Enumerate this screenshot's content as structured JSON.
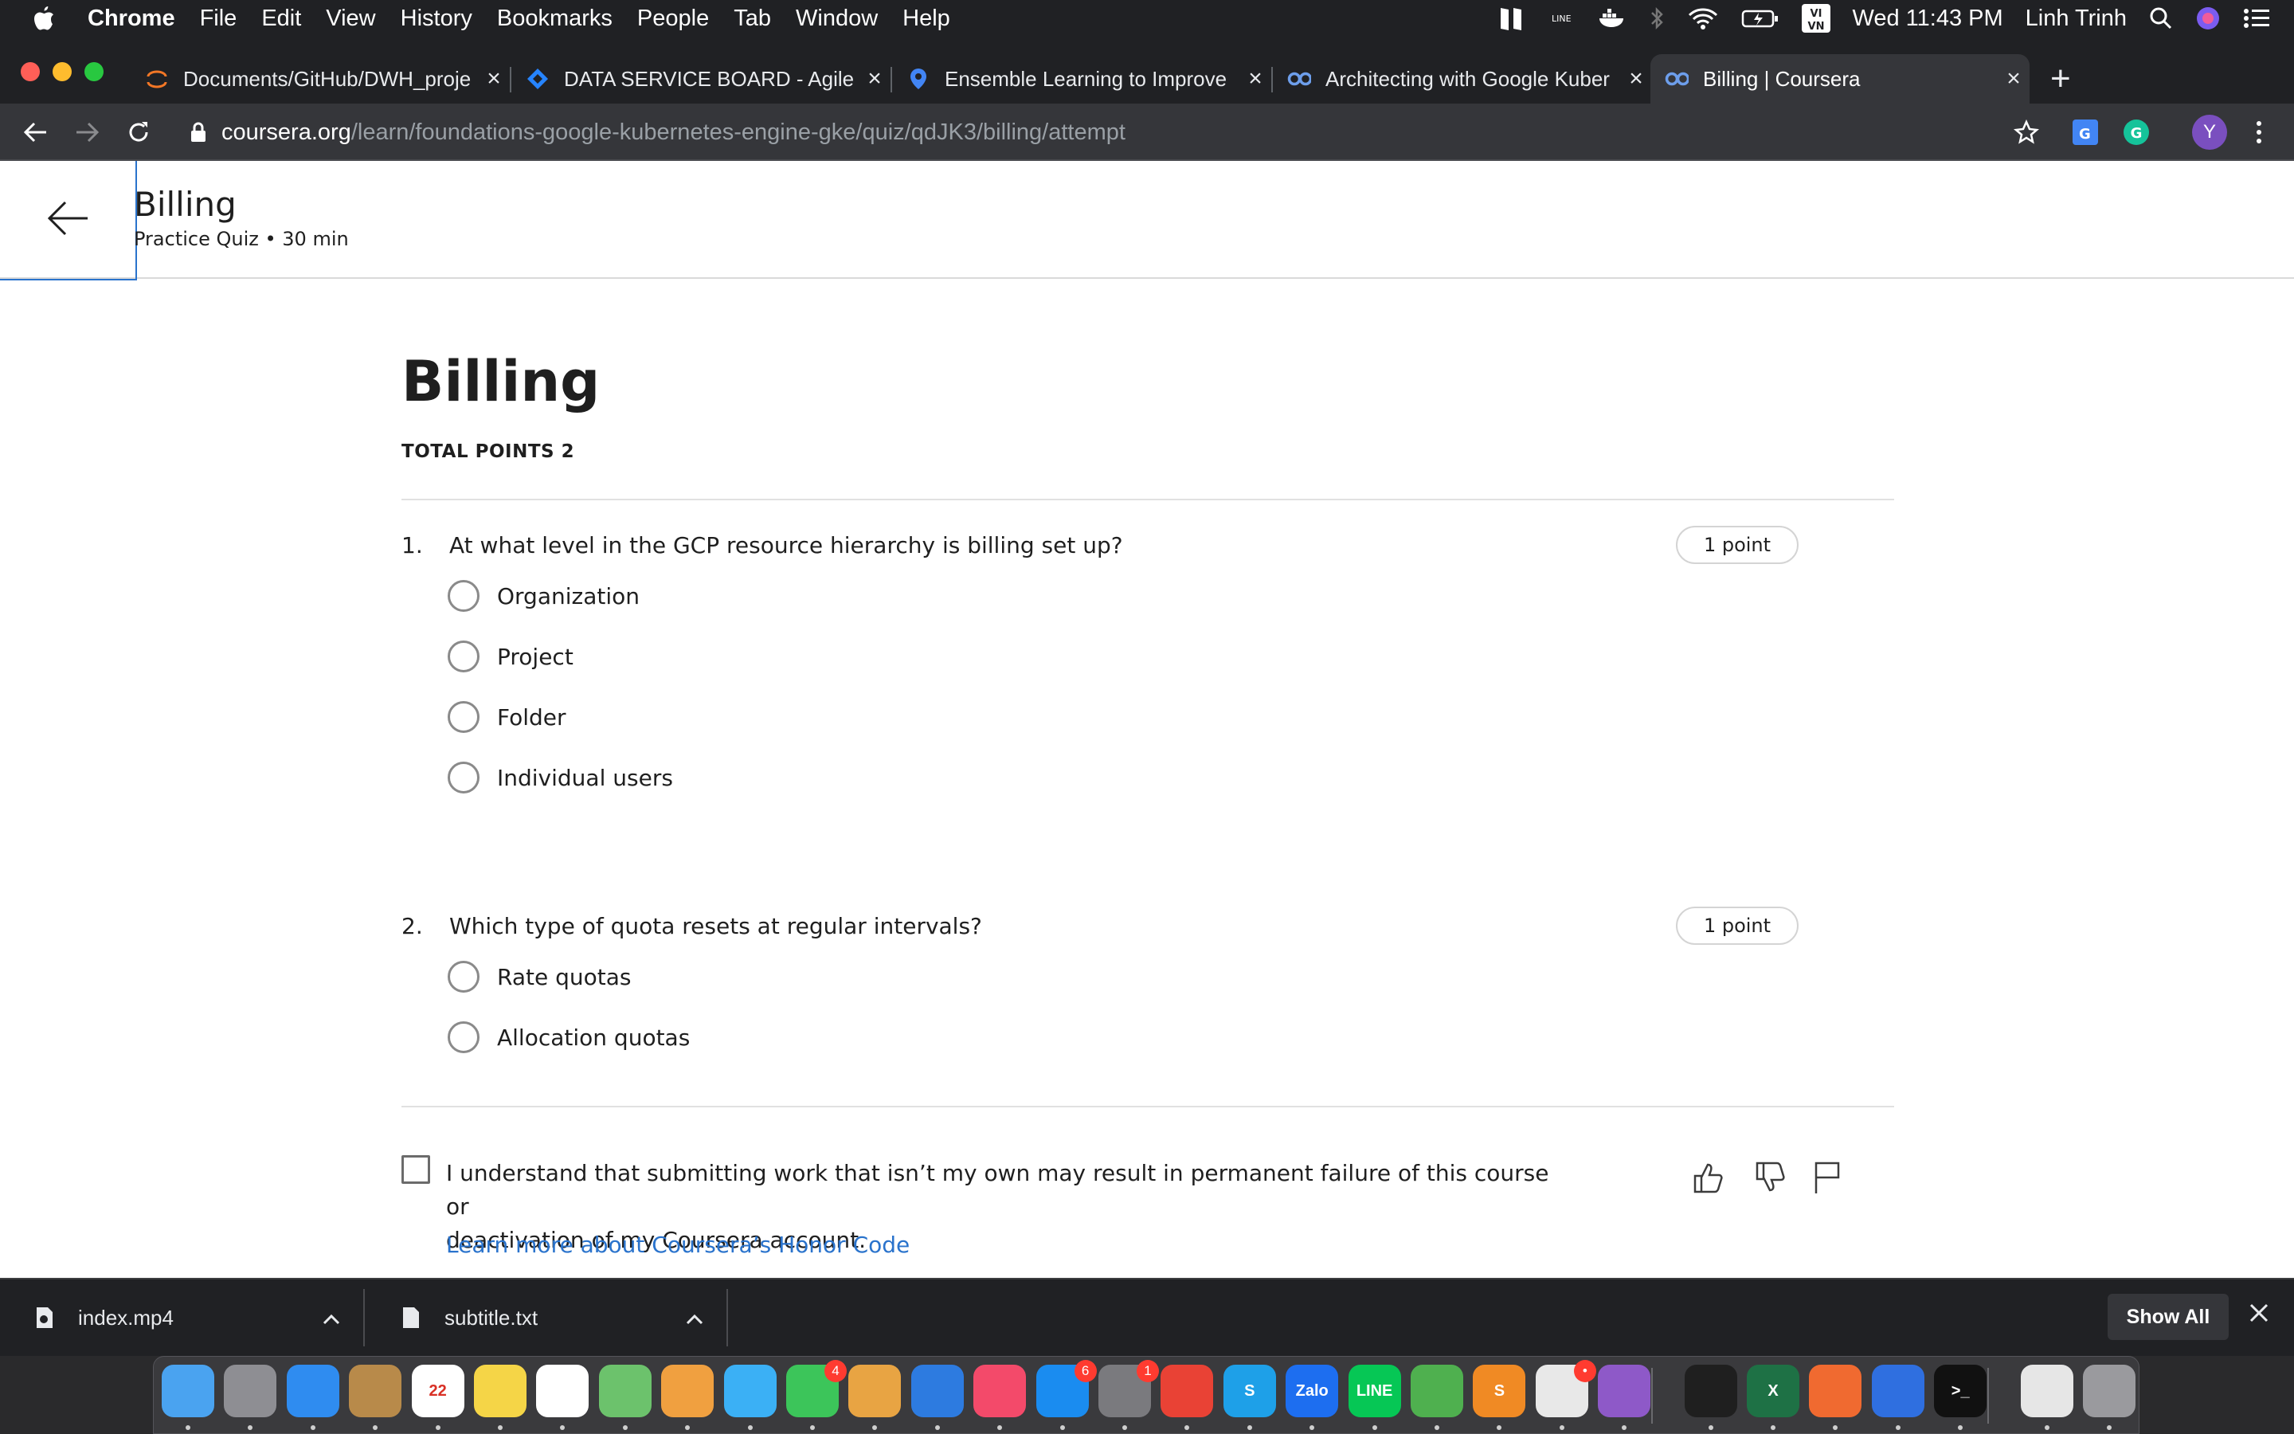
{
  "menubar": {
    "app_name": "Chrome",
    "menus": [
      "File",
      "Edit",
      "View",
      "History",
      "Bookmarks",
      "People",
      "Tab",
      "Window",
      "Help"
    ],
    "clock": "Wed 11:43 PM",
    "user": "Linh Trinh",
    "input_method": "VI VN",
    "status_icons": [
      "split-view-icon",
      "line-app-icon",
      "docker-icon",
      "bluetooth-icon",
      "wifi-icon",
      "battery-icon",
      "input-method-icon",
      "spotlight-icon",
      "siri-icon",
      "notification-center-icon"
    ]
  },
  "tabs": [
    {
      "title": "Documents/GitHub/DWH_proje",
      "icon": "jupyter-icon"
    },
    {
      "title": "DATA SERVICE BOARD - Agile B",
      "icon": "jira-icon"
    },
    {
      "title": "Ensemble Learning to Improve",
      "icon": "pin-icon"
    },
    {
      "title": "Architecting with Google Kuber",
      "icon": "coursera-icon"
    },
    {
      "title": "Billing | Coursera",
      "icon": "coursera-icon",
      "active": true
    }
  ],
  "address": {
    "host": "coursera.org",
    "path": "/learn/foundations-google-kubernetes-engine-gke/quiz/qdJK3/billing/attempt"
  },
  "profile_initial": "Y",
  "colors": {
    "chrome_dark": "#202124",
    "chrome_toolbar": "#35363a",
    "link_blue": "#2a73cc",
    "text_dark": "#1f1f1f"
  },
  "header": {
    "title": "Billing",
    "subtitle": "Practice Quiz • 30 min"
  },
  "quiz": {
    "title": "Billing",
    "total_points": "TOTAL POINTS 2",
    "questions": [
      {
        "number": "1.",
        "text": "At what level in the GCP resource hierarchy is billing set up?",
        "points": "1 point",
        "options": [
          "Organization",
          "Project",
          "Folder",
          "Individual users"
        ]
      },
      {
        "number": "2.",
        "text": "Which type of quota resets at regular intervals?",
        "points": "1 point",
        "options": [
          "Rate quotas",
          "Allocation quotas"
        ]
      }
    ]
  },
  "honor": {
    "line1": "I understand that submitting work that isn’t my own may result in permanent failure of this course or",
    "line2": "deactivation of my Coursera account.",
    "link": "Learn more about Coursera’s Honor Code"
  },
  "downloads": {
    "items": [
      {
        "name": "index.mp4",
        "icon": "video-file-icon"
      },
      {
        "name": "subtitle.txt",
        "icon": "text-file-icon"
      }
    ],
    "show_all": "Show All"
  },
  "dock": {
    "apps": [
      {
        "name": "finder",
        "color": "#4aa3f0",
        "label": ""
      },
      {
        "name": "launchpad",
        "color": "#8e8e93",
        "label": ""
      },
      {
        "name": "safari",
        "color": "#2f8cf0",
        "label": ""
      },
      {
        "name": "contacts",
        "color": "#b88a4a",
        "label": ""
      },
      {
        "name": "calendar",
        "color": "#ffffff",
        "label": "22"
      },
      {
        "name": "notes",
        "color": "#f5d547",
        "label": ""
      },
      {
        "name": "reminders",
        "color": "#ffffff",
        "label": ""
      },
      {
        "name": "maps",
        "color": "#6cc26c",
        "label": ""
      },
      {
        "name": "photos",
        "color": "#f0a040",
        "label": ""
      },
      {
        "name": "messages",
        "color": "#3bb0f5",
        "label": ""
      },
      {
        "name": "facetime",
        "color": "#3cc55a",
        "label": "",
        "badge": "4"
      },
      {
        "name": "preview",
        "color": "#e8a443",
        "label": ""
      },
      {
        "name": "keynote",
        "color": "#2d7be0",
        "label": ""
      },
      {
        "name": "music",
        "color": "#f34a6a",
        "label": ""
      },
      {
        "name": "app-store",
        "color": "#1a8cf0",
        "label": "",
        "badge": "6"
      },
      {
        "name": "system-preferences",
        "color": "#7a7a7e",
        "label": "",
        "badge": "1"
      },
      {
        "name": "chrome",
        "color": "#e94235",
        "label": ""
      },
      {
        "name": "skype",
        "color": "#1ea0e8",
        "label": "S"
      },
      {
        "name": "zalo",
        "color": "#1d6ef0",
        "label": "Zalo"
      },
      {
        "name": "line",
        "color": "#06c755",
        "label": "LINE"
      },
      {
        "name": "sequel",
        "color": "#4fb04f",
        "label": ""
      },
      {
        "name": "sublime-text",
        "color": "#f08a24",
        "label": "S"
      },
      {
        "name": "slack",
        "color": "#e8e8e8",
        "label": "",
        "badge": "•"
      },
      {
        "name": "github-desktop",
        "color": "#8e59c8",
        "label": ""
      },
      {
        "name": "activity-monitor",
        "color": "#1f1f1f",
        "label": ""
      },
      {
        "name": "excel",
        "color": "#1e7145",
        "label": "X"
      },
      {
        "name": "pencil",
        "color": "#f06a30",
        "label": ""
      },
      {
        "name": "split-view",
        "color": "#2f6fe0",
        "label": ""
      },
      {
        "name": "terminal",
        "color": "#111111",
        "label": ">_"
      },
      {
        "name": "documents",
        "color": "#e6e6e6",
        "label": ""
      },
      {
        "name": "trash",
        "color": "#9a9a9e",
        "label": ""
      }
    ]
  }
}
